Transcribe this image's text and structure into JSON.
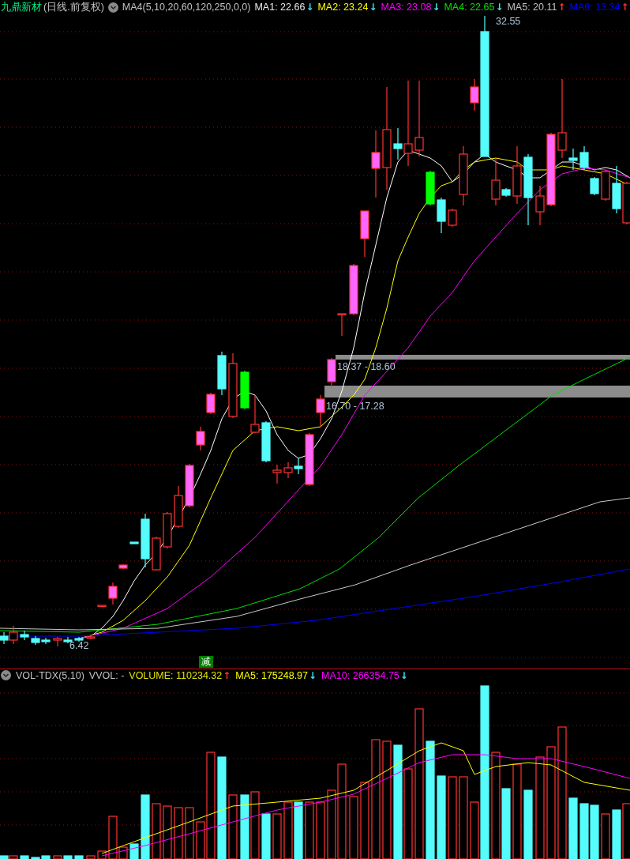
{
  "title": {
    "name": "九鼎新材",
    "mode": "(日线.前复权)"
  },
  "indicator": "MA4(5,10,20,60,120,250,0,0)",
  "ma_legend": [
    {
      "label": "MA1: 22.66",
      "color": "#e8e8e8",
      "trend": "↓"
    },
    {
      "label": "MA2: 23.24",
      "color": "#ffff00",
      "trend": "↓"
    },
    {
      "label": "MA3: 23.08",
      "color": "#ff00ff",
      "trend": "↓"
    },
    {
      "label": "MA4: 22.65",
      "color": "#00e000",
      "trend": "↓"
    },
    {
      "label": "MA5: 20.11",
      "color": "#c0c0c0",
      "trend": "↑"
    },
    {
      "label": "MA6: 13.34",
      "color": "#0000ff",
      "trend": "↑"
    }
  ],
  "chart_labels": {
    "high": "32.55",
    "low": "6.42",
    "band_upper": "18.37 - 18.60",
    "band_lower": "16.70 - 17.28",
    "signal": "减"
  },
  "volume_panel": {
    "indicator": "VOL-TDX(5,10)",
    "vvol": "VVOL: -",
    "legend": [
      {
        "label": "VOLUME: 110234.32",
        "color": "#e0e000",
        "trend": "↑"
      },
      {
        "label": "MA5: 175248.97",
        "color": "#ffff00",
        "trend": "↓"
      },
      {
        "label": "MA10: 266354.75",
        "color": "#ff00ff",
        "trend": "↓"
      }
    ]
  }
}
